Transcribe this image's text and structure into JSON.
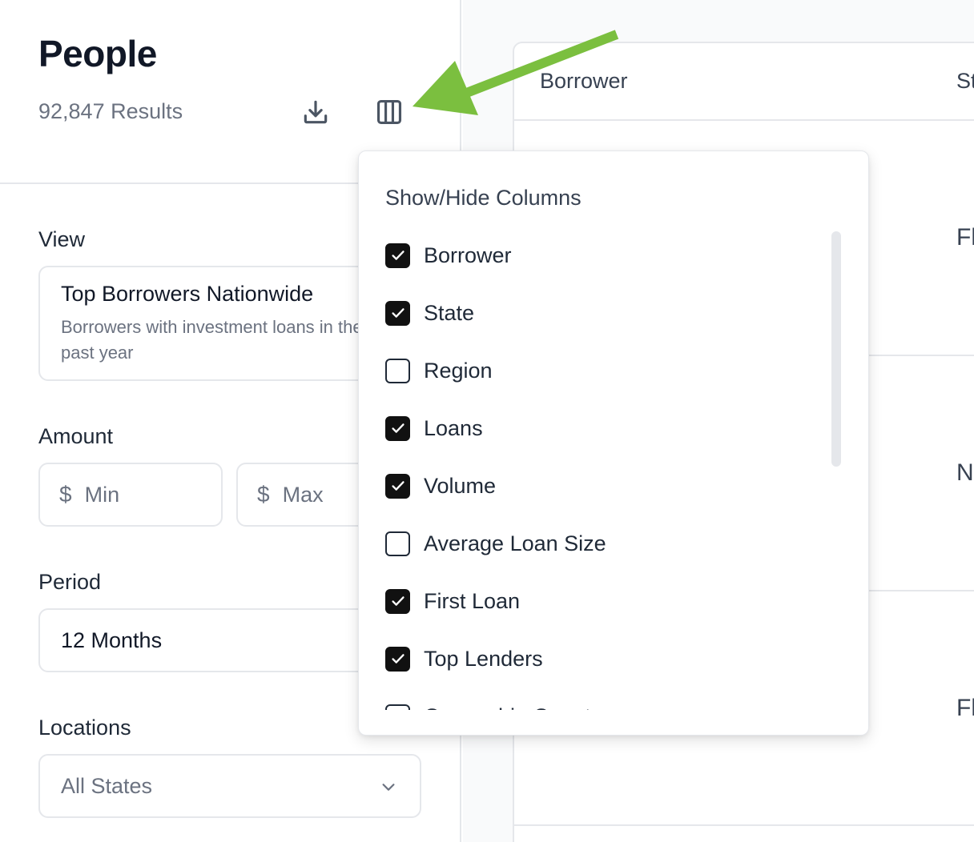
{
  "page": {
    "title": "People",
    "results": "92,847 Results"
  },
  "toolbar": {
    "download_icon": "download-icon",
    "columns_icon": "columns-icon"
  },
  "filters": {
    "view": {
      "label": "View",
      "title": "Top Borrowers Nationwide",
      "description": "Borrowers with investment loans in the past year"
    },
    "amount": {
      "label": "Amount",
      "currency": "$",
      "min_placeholder": "Min",
      "max_placeholder": "Max"
    },
    "period": {
      "label": "Period",
      "value": "12 Months"
    },
    "locations": {
      "label": "Locations",
      "value": "All States"
    }
  },
  "table": {
    "headers": [
      "Borrower",
      "St"
    ],
    "state_cells": [
      "Fl",
      "N",
      "Fl"
    ]
  },
  "column_menu": {
    "title": "Show/Hide Columns",
    "options": [
      {
        "label": "Borrower",
        "checked": true
      },
      {
        "label": "State",
        "checked": true
      },
      {
        "label": "Region",
        "checked": false
      },
      {
        "label": "Loans",
        "checked": true
      },
      {
        "label": "Volume",
        "checked": true
      },
      {
        "label": "Average Loan Size",
        "checked": false
      },
      {
        "label": "First Loan",
        "checked": true
      },
      {
        "label": "Top Lenders",
        "checked": true
      },
      {
        "label": "Ownership Count",
        "checked": false
      }
    ]
  },
  "colors": {
    "accent_arrow": "#7bbf3f",
    "checkbox_checked": "#111111",
    "border": "#e5e7eb",
    "muted_text": "#6b7280"
  }
}
